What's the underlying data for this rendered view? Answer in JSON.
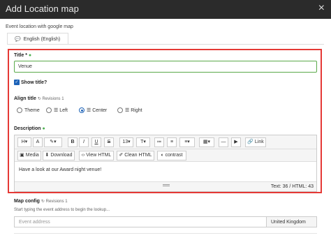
{
  "window": {
    "title": "Add Location map",
    "close_symbol": "×"
  },
  "subtitle": "Event location with google map",
  "language_tab": {
    "label": "English (English)"
  },
  "title_field": {
    "label": "Title *",
    "value": "Venue"
  },
  "show_title": {
    "label": "Show title?",
    "checked": true
  },
  "align_title": {
    "label": "Align title",
    "revisions": "Revisions 1",
    "options": [
      "Theme",
      "Left",
      "Center",
      "Right"
    ],
    "selected": "Center"
  },
  "description": {
    "label": "Description",
    "toolbar_row1": {
      "heading": "H",
      "font": "A",
      "brush": "✎",
      "bold": "B",
      "italic": "I",
      "underline": "U",
      "strike": "S",
      "font_size": "13",
      "text_style": "T",
      "link": "Link"
    },
    "toolbar_row2": {
      "media": "Media",
      "download": "Download",
      "view_html": "View HTML",
      "clean_html": "Clean HTML",
      "contrast": "contrast"
    },
    "content": "Have a look at our Award night venue!",
    "counter": "Text: 36 / HTML: 43"
  },
  "map_config": {
    "label": "Map config",
    "revisions": "Revisions 1",
    "hint": "Start typing the event address to begin the lookup...",
    "address_placeholder": "Event address",
    "country_value": "United Kingdom"
  },
  "colors": {
    "accent": "#1e63b8",
    "highlight": "#e53935",
    "titlebar": "#2b2b2b",
    "valid": "#5aaa4a"
  }
}
